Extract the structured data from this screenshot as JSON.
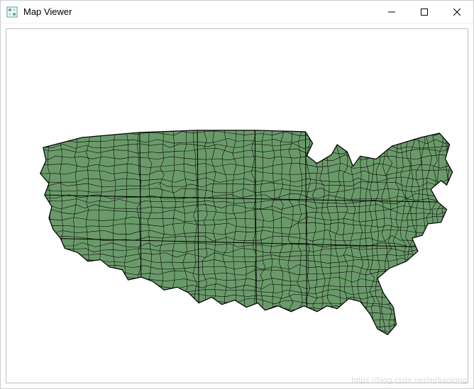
{
  "window": {
    "title": "Map Viewer",
    "icon": "map-app-icon",
    "controls": {
      "minimize": "minimize-icon",
      "maximize": "maximize-icon",
      "close": "close-icon"
    }
  },
  "map": {
    "fill_color": "#6a9a6a",
    "stroke_color": "#000000",
    "description": "US counties choropleth outline map"
  },
  "watermark": "https://blog.csdn.net/mrbaolong"
}
